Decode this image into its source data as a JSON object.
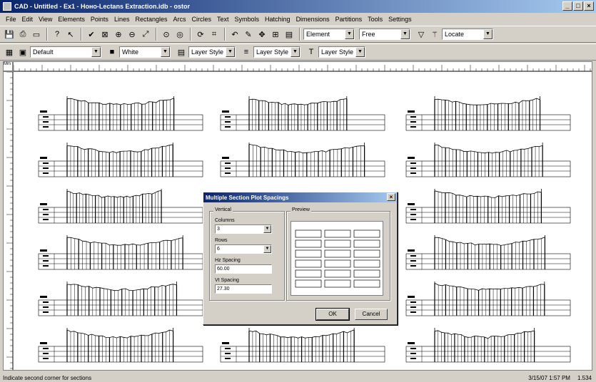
{
  "window": {
    "title": "CAD - Untitled - Ex1 - Ноно-Lectans Extraction.idb - ostor",
    "min": "_",
    "max": "□",
    "close": "×"
  },
  "menu": [
    "File",
    "Edit",
    "View",
    "Elements",
    "Points",
    "Lines",
    "Rectangles",
    "Arcs",
    "Circles",
    "Text",
    "Symbols",
    "Hatching",
    "Dimensions",
    "Partitions",
    "Tools",
    "Settings"
  ],
  "toolbar1": {
    "combo_element": "Element",
    "combo_free": "Free",
    "combo_locate": "Locate"
  },
  "toolbar2": {
    "combo_layer": "Default",
    "combo_color": "White",
    "combo_style1": "Layer Style",
    "combo_style2": "Layer Style",
    "combo_style3": "Layer Style"
  },
  "ruler": {
    "corner": "Mm"
  },
  "status": {
    "message": "Indicate second corner for sections",
    "date": "3/15/07 1:57 PM",
    "zoom": "1.534"
  },
  "dialog": {
    "title": "Multiple Section Plot Spacings",
    "close": "×",
    "vertical_group": "Vertical",
    "columns_label": "Columns",
    "columns_value": "3",
    "rows_label": "Rows",
    "rows_value": "6",
    "hz_label": "Hz Spacing",
    "hz_value": "60.00",
    "vt_label": "Vt Spacing",
    "vt_value": "27.30",
    "preview_group": "Preview",
    "ok": "OK",
    "cancel": "Cancel"
  }
}
